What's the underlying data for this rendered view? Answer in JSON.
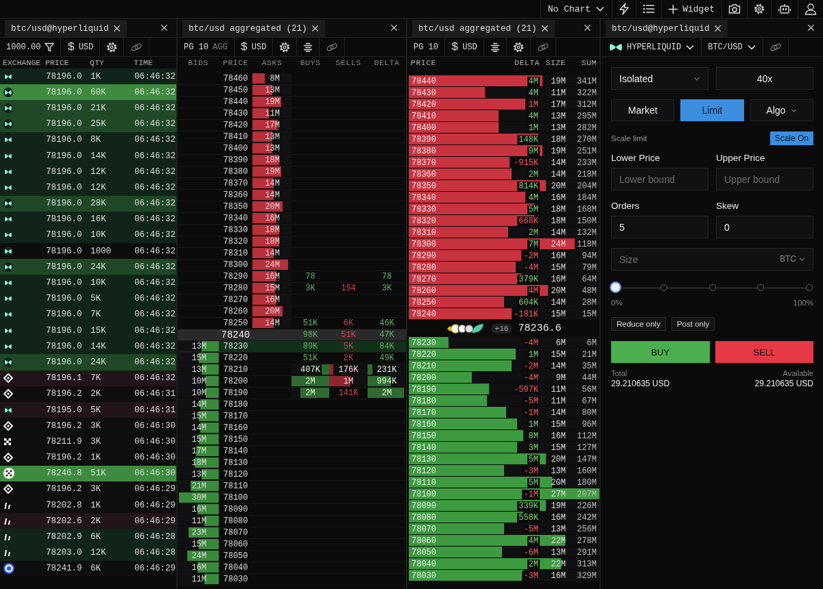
{
  "top_bar": {
    "chart_select": "No Chart",
    "widget_button": "Widget"
  },
  "trades_panel": {
    "tab": "btc/usd@hyperliquid",
    "filter_value": "1000.00",
    "currency_symbol": "$",
    "currency": "USD",
    "columns": [
      "EXCHANGE",
      "PRICE",
      "QTY",
      "TIME"
    ],
    "rows": [
      {
        "kind": "bowtie",
        "color": "#11241a",
        "price": "78196.0",
        "qty": "1K",
        "time": "06:46:32"
      },
      {
        "kind": "bowtie",
        "color": "#3e8b3f",
        "price": "78196.0",
        "qty": "60K",
        "time": "06:46:32"
      },
      {
        "kind": "bowtie",
        "color": "#1e4826",
        "price": "78196.0",
        "qty": "21K",
        "time": "06:46:32"
      },
      {
        "kind": "bowtie",
        "color": "#1e4826",
        "price": "78196.0",
        "qty": "25K",
        "time": "06:46:32"
      },
      {
        "kind": "bowtie",
        "color": "#11241a",
        "price": "78196.0",
        "qty": "8K",
        "time": "06:46:32"
      },
      {
        "kind": "bowtie",
        "color": "#11241a",
        "price": "78196.0",
        "qty": "14K",
        "time": "06:46:32"
      },
      {
        "kind": "bowtie",
        "color": "#11241a",
        "price": "78196.0",
        "qty": "12K",
        "time": "06:46:32"
      },
      {
        "kind": "bowtie",
        "color": "#11241a",
        "price": "78196.0",
        "qty": "12K",
        "time": "06:46:32"
      },
      {
        "kind": "bowtie",
        "color": "#1e4826",
        "price": "78196.0",
        "qty": "28K",
        "time": "06:46:32"
      },
      {
        "kind": "bowtie",
        "color": "#11241a",
        "price": "78196.0",
        "qty": "16K",
        "time": "06:46:32"
      },
      {
        "kind": "bowtie",
        "color": "#11241a",
        "price": "78196.0",
        "qty": "10K",
        "time": "06:46:32"
      },
      {
        "kind": "bowtie",
        "color": "#0d0d0e",
        "price": "78196.0",
        "qty": "1000",
        "time": "06:46:32"
      },
      {
        "kind": "bowtie",
        "color": "#1e4826",
        "price": "78196.0",
        "qty": "24K",
        "time": "06:46:32"
      },
      {
        "kind": "bowtie",
        "color": "#11241a",
        "price": "78196.0",
        "qty": "10K",
        "time": "06:46:32"
      },
      {
        "kind": "bowtie",
        "color": "#11241a",
        "price": "78196.0",
        "qty": "5K",
        "time": "06:46:32"
      },
      {
        "kind": "bowtie",
        "color": "#11241a",
        "price": "78196.0",
        "qty": "7K",
        "time": "06:46:32"
      },
      {
        "kind": "bowtie",
        "color": "#11241a",
        "price": "78196.0",
        "qty": "15K",
        "time": "06:46:32"
      },
      {
        "kind": "bowtie",
        "color": "#11241a",
        "price": "78196.0",
        "qty": "14K",
        "time": "06:46:32"
      },
      {
        "kind": "bowtie",
        "color": "#1e4826",
        "price": "78196.0",
        "qty": "24K",
        "time": "06:46:32"
      },
      {
        "kind": "diamond",
        "color": "#21141a",
        "price": "78196.1",
        "qty": "7K",
        "time": "06:46:32"
      },
      {
        "kind": "diamond",
        "color": "#0e0d0f",
        "price": "78196.2",
        "qty": "2K",
        "time": "06:46:31"
      },
      {
        "kind": "bowtie",
        "color": "#21141a",
        "price": "78195.0",
        "qty": "5K",
        "time": "06:46:31"
      },
      {
        "kind": "diamond",
        "color": "#0e0d0f",
        "price": "78196.2",
        "qty": "3K",
        "time": "06:46:30"
      },
      {
        "kind": "checker",
        "color": "#0e0d0f",
        "price": "78211.9",
        "qty": "3K",
        "time": "06:46:30"
      },
      {
        "kind": "diamond",
        "color": "#0e0d0f",
        "price": "78196.2",
        "qty": "1K",
        "time": "06:46:30"
      },
      {
        "kind": "dotted",
        "color": "#3e8b3f",
        "price": "78246.8",
        "qty": "51K",
        "time": "06:46:30"
      },
      {
        "kind": "diamond",
        "color": "#0e0d0f",
        "price": "78196.2",
        "qty": "3K",
        "time": "06:46:29"
      },
      {
        "kind": "slash",
        "color": "#0e0d0f",
        "price": "78202.8",
        "qty": "1K",
        "time": "06:46:29"
      },
      {
        "kind": "slash",
        "color": "#21141a",
        "price": "78202.6",
        "qty": "2K",
        "time": "06:46:29"
      },
      {
        "kind": "slash",
        "color": "#11241a",
        "price": "78202.9",
        "qty": "6K",
        "time": "06:46:28"
      },
      {
        "kind": "slash",
        "color": "#11241a",
        "price": "78203.0",
        "qty": "12K",
        "time": "06:46:28"
      },
      {
        "kind": "ring",
        "color": "#0e0d0f",
        "price": "78241.9",
        "qty": "6K",
        "time": "06:46:29"
      }
    ]
  },
  "ladder_panel": {
    "tab": "btc/usd aggregated (21)",
    "page": "PG 10",
    "agg": "AGG",
    "currency_symbol": "$",
    "currency": "USD",
    "columns": [
      "BIDS",
      "PRICE",
      "ASKS",
      "BUYS",
      "SELLS",
      "DELTA"
    ],
    "rows": [
      {
        "kind": "ask",
        "highlight": false,
        "price": "78460",
        "size": {
          "text": "8M",
          "level": 0.31
        }
      },
      {
        "kind": "ask",
        "highlight": false,
        "price": "78450",
        "size": {
          "text": "13M",
          "level": 0.5
        }
      },
      {
        "kind": "ask",
        "highlight": false,
        "price": "78440",
        "size": {
          "text": "19M",
          "level": 0.73
        }
      },
      {
        "kind": "ask",
        "highlight": false,
        "price": "78430",
        "size": {
          "text": "11M",
          "level": 0.42
        }
      },
      {
        "kind": "ask",
        "highlight": false,
        "price": "78420",
        "size": {
          "text": "17M",
          "level": 0.65
        }
      },
      {
        "kind": "ask",
        "highlight": false,
        "price": "78410",
        "size": {
          "text": "13M",
          "level": 0.5
        }
      },
      {
        "kind": "ask",
        "highlight": false,
        "price": "78400",
        "size": {
          "text": "13M",
          "level": 0.5
        }
      },
      {
        "kind": "ask",
        "highlight": false,
        "price": "78390",
        "size": {
          "text": "18M",
          "level": 0.69
        }
      },
      {
        "kind": "ask",
        "highlight": false,
        "price": "78380",
        "size": {
          "text": "19M",
          "level": 0.73
        }
      },
      {
        "kind": "ask",
        "highlight": false,
        "price": "78370",
        "size": {
          "text": "14M",
          "level": 0.54
        }
      },
      {
        "kind": "ask",
        "highlight": false,
        "price": "78360",
        "size": {
          "text": "14M",
          "level": 0.54
        }
      },
      {
        "kind": "ask",
        "highlight": false,
        "price": "78350",
        "size": {
          "text": "20M",
          "level": 0.77
        }
      },
      {
        "kind": "ask",
        "highlight": false,
        "price": "78340",
        "size": {
          "text": "16M",
          "level": 0.62
        }
      },
      {
        "kind": "ask",
        "highlight": false,
        "price": "78330",
        "size": {
          "text": "18M",
          "level": 0.69
        }
      },
      {
        "kind": "ask",
        "highlight": false,
        "price": "78320",
        "size": {
          "text": "18M",
          "level": 0.69
        }
      },
      {
        "kind": "ask",
        "highlight": false,
        "price": "78310",
        "size": {
          "text": "14M",
          "level": 0.54
        }
      },
      {
        "kind": "ask",
        "highlight": false,
        "price": "78300",
        "size": {
          "text": "24M",
          "level": 0.92
        }
      },
      {
        "kind": "ask",
        "highlight": false,
        "price": "78290",
        "size": {
          "text": "16M",
          "level": 0.62
        },
        "buys": {
          "text": "78"
        },
        "delta": {
          "text": "78"
        }
      },
      {
        "kind": "ask",
        "highlight": false,
        "price": "78280",
        "size": {
          "text": "15M",
          "level": 0.58
        },
        "buys": {
          "text": "3K"
        },
        "sells": {
          "text": "154"
        },
        "delta": {
          "text": "3K"
        }
      },
      {
        "kind": "ask",
        "highlight": false,
        "price": "78270",
        "size": {
          "text": "16M",
          "level": 0.62
        }
      },
      {
        "kind": "ask",
        "highlight": false,
        "price": "78260",
        "size": {
          "text": "20M",
          "level": 0.77
        }
      },
      {
        "kind": "ask",
        "highlight": false,
        "price": "78250",
        "size": {
          "text": "14M",
          "level": 0.54
        },
        "buys": {
          "text": "51K"
        },
        "sells": {
          "text": "6K"
        },
        "delta": {
          "text": "46K"
        }
      },
      {
        "kind": "mid",
        "highlight": false,
        "price": "78240",
        "buys": {
          "text": "98K"
        },
        "sells": {
          "text": "51K"
        },
        "delta": {
          "text": "47K"
        }
      },
      {
        "kind": "bid",
        "highlight": true,
        "price": "78230",
        "size": {
          "text": "13M",
          "level": 0.42
        },
        "buys": {
          "text": "89K"
        },
        "sells": {
          "text": "5K"
        },
        "delta": {
          "text": "84K"
        }
      },
      {
        "kind": "bid",
        "highlight": false,
        "price": "78220",
        "size": {
          "text": "15M",
          "level": 0.48
        },
        "buys": {
          "text": "51K"
        },
        "sells": {
          "text": "2K"
        },
        "delta": {
          "text": "49K"
        }
      },
      {
        "kind": "bid",
        "highlight": false,
        "price": "78210",
        "size": {
          "text": "13M",
          "level": 0.42
        },
        "buys": {
          "text": "407K",
          "level": 0.2
        },
        "sells": {
          "text": "176K",
          "level": 0.1
        },
        "delta": {
          "text": "231K",
          "level": 0.12
        }
      },
      {
        "kind": "bid",
        "highlight": false,
        "price": "78200",
        "size": {
          "text": "10M",
          "level": 0.32
        },
        "buys": {
          "text": "2M",
          "level": 1
        },
        "sells": {
          "text": "1M",
          "level": 0.55
        },
        "delta": {
          "text": "994K",
          "level": 0.6
        }
      },
      {
        "kind": "bid",
        "highlight": false,
        "price": "78190",
        "size": {
          "text": "10M",
          "level": 0.32
        },
        "buys": {
          "text": "2M",
          "level": 0.77
        },
        "sells": {
          "text": "141K"
        },
        "delta": {
          "text": "2M",
          "level": 0.95
        }
      },
      {
        "kind": "bid",
        "highlight": false,
        "price": "78180",
        "size": {
          "text": "14M",
          "level": 0.45
        }
      },
      {
        "kind": "bid",
        "highlight": false,
        "price": "78170",
        "size": {
          "text": "15M",
          "level": 0.48
        }
      },
      {
        "kind": "bid",
        "highlight": false,
        "price": "78160",
        "size": {
          "text": "14M",
          "level": 0.45
        }
      },
      {
        "kind": "bid",
        "highlight": false,
        "price": "78150",
        "size": {
          "text": "15M",
          "level": 0.48
        }
      },
      {
        "kind": "bid",
        "highlight": false,
        "price": "78140",
        "size": {
          "text": "17M",
          "level": 0.55
        }
      },
      {
        "kind": "bid",
        "highlight": false,
        "price": "78130",
        "size": {
          "text": "18M",
          "level": 0.58
        }
      },
      {
        "kind": "bid",
        "highlight": false,
        "price": "78120",
        "size": {
          "text": "13M",
          "level": 0.42
        }
      },
      {
        "kind": "bid",
        "highlight": false,
        "price": "78110",
        "size": {
          "text": "21M",
          "level": 0.68
        }
      },
      {
        "kind": "bid",
        "highlight": false,
        "price": "78100",
        "size": {
          "text": "30M",
          "level": 0.97
        }
      },
      {
        "kind": "bid",
        "highlight": false,
        "price": "78090",
        "size": {
          "text": "16M",
          "level": 0.52
        }
      },
      {
        "kind": "bid",
        "highlight": false,
        "price": "78080",
        "size": {
          "text": "11M",
          "level": 0.35
        }
      },
      {
        "kind": "bid",
        "highlight": false,
        "price": "78070",
        "size": {
          "text": "23M",
          "level": 0.74
        }
      },
      {
        "kind": "bid",
        "highlight": false,
        "price": "78060",
        "size": {
          "text": "15M",
          "level": 0.48
        }
      },
      {
        "kind": "bid",
        "highlight": false,
        "price": "78050",
        "size": {
          "text": "24M",
          "level": 0.77
        }
      },
      {
        "kind": "bid",
        "highlight": false,
        "price": "78040",
        "size": {
          "text": "16M",
          "level": 0.52
        }
      },
      {
        "kind": "bid",
        "highlight": false,
        "price": "78030",
        "size": {
          "text": "11M",
          "level": 0.35
        }
      }
    ]
  },
  "book_panel": {
    "tab": "btc/usd aggregated (21)",
    "page": "PG 10",
    "currency_symbol": "$",
    "currency": "USD",
    "columns": [
      "PRICE",
      "DELTA",
      "SIZE",
      "SUM"
    ],
    "asks": [
      {
        "price": "78440",
        "delta": "4M",
        "negative": false,
        "size": "19M",
        "sum": "341M",
        "level": 0.7
      },
      {
        "price": "78430",
        "delta": "4M",
        "negative": false,
        "size": "11M",
        "sum": "322M",
        "level": 0.4
      },
      {
        "price": "78420",
        "delta": "1M",
        "negative": true,
        "size": "17M",
        "sum": "312M",
        "level": 0.61
      },
      {
        "price": "78410",
        "delta": "4M",
        "negative": false,
        "size": "13M",
        "sum": "295M",
        "level": 0.47
      },
      {
        "price": "78400",
        "delta": "1M",
        "negative": false,
        "size": "13M",
        "sum": "282M",
        "level": 0.47
      },
      {
        "price": "78390",
        "delta": "148K",
        "negative": false,
        "size": "18M",
        "sum": "270M",
        "level": 0.68
      },
      {
        "price": "78380",
        "delta": "9M",
        "negative": false,
        "size": "19M",
        "sum": "251M",
        "level": 0.7
      },
      {
        "price": "78370",
        "delta": "-915K",
        "negative": true,
        "size": "14M",
        "sum": "233M",
        "level": 0.53
      },
      {
        "price": "78360",
        "delta": "2M",
        "negative": false,
        "size": "14M",
        "sum": "218M",
        "level": 0.54
      },
      {
        "price": "78350",
        "delta": "814K",
        "negative": false,
        "size": "20M",
        "sum": "204M",
        "level": 0.72
      },
      {
        "price": "78340",
        "delta": "4M",
        "negative": false,
        "size": "16M",
        "sum": "184M",
        "level": 0.61
      },
      {
        "price": "78330",
        "delta": "5M",
        "negative": false,
        "size": "18M",
        "sum": "168M",
        "level": 0.66
      },
      {
        "price": "78320",
        "delta": "668K",
        "negative": true,
        "size": "18M",
        "sum": "150M",
        "level": 0.66
      },
      {
        "price": "78310",
        "delta": "2M",
        "negative": false,
        "size": "14M",
        "sum": "132M",
        "level": 0.52
      },
      {
        "price": "78300",
        "delta": "7M",
        "negative": false,
        "size": "24M",
        "sum": "118M",
        "level": 0.87
      },
      {
        "price": "78290",
        "delta": "-2M",
        "negative": true,
        "size": "16M",
        "sum": "94M",
        "level": 0.59
      },
      {
        "price": "78280",
        "delta": "-4M",
        "negative": true,
        "size": "15M",
        "sum": "79M",
        "level": 0.56
      },
      {
        "price": "78270",
        "delta": "379K",
        "negative": false,
        "size": "16M",
        "sum": "64M",
        "level": 0.59
      },
      {
        "price": "78260",
        "delta": "4M",
        "negative": true,
        "size": "20M",
        "sum": "48M",
        "level": 0.73
      },
      {
        "price": "78250",
        "delta": "604K",
        "negative": false,
        "size": "14M",
        "sum": "28M",
        "level": 0.5
      },
      {
        "price": "78240",
        "delta": "-181K",
        "negative": true,
        "size": "15M",
        "sum": "15M",
        "level": 0.54
      }
    ],
    "mid": {
      "extra": "+16",
      "price": "78236.6"
    },
    "bids": [
      {
        "price": "78230",
        "delta": "-4M",
        "negative": true,
        "size": "6M",
        "sum": "6M",
        "level": 0.21
      },
      {
        "price": "78220",
        "delta": "1M",
        "negative": false,
        "size": "15M",
        "sum": "21M",
        "level": 0.56
      },
      {
        "price": "78210",
        "delta": "-2M",
        "negative": true,
        "size": "14M",
        "sum": "35M",
        "level": 0.54
      },
      {
        "price": "78200",
        "delta": "-4M",
        "negative": true,
        "size": "9M",
        "sum": "44M",
        "level": 0.33
      },
      {
        "price": "78190",
        "delta": "-597K",
        "negative": true,
        "size": "11M",
        "sum": "56M",
        "level": 0.42
      },
      {
        "price": "78180",
        "delta": "-5M",
        "negative": true,
        "size": "11M",
        "sum": "67M",
        "level": 0.41
      },
      {
        "price": "78170",
        "delta": "-1M",
        "negative": true,
        "size": "14M",
        "sum": "80M",
        "level": 0.51
      },
      {
        "price": "78160",
        "delta": "1M",
        "negative": false,
        "size": "15M",
        "sum": "96M",
        "level": 0.57
      },
      {
        "price": "78150",
        "delta": "8M",
        "negative": false,
        "size": "16M",
        "sum": "112M",
        "level": 0.6
      },
      {
        "price": "78140",
        "delta": "3M",
        "negative": false,
        "size": "15M",
        "sum": "127M",
        "level": 0.57
      },
      {
        "price": "78130",
        "delta": "5M",
        "negative": false,
        "size": "20M",
        "sum": "147M",
        "level": 0.72
      },
      {
        "price": "78120",
        "delta": "-3M",
        "negative": true,
        "size": "13M",
        "sum": "160M",
        "level": 0.5
      },
      {
        "price": "78110",
        "delta": "5M",
        "negative": false,
        "size": "20M",
        "sum": "180M",
        "level": 0.75
      },
      {
        "price": "78100",
        "delta": "-1M",
        "negative": true,
        "size": "27M",
        "sum": "207M",
        "level": 1
      },
      {
        "price": "78090",
        "delta": "339K",
        "negative": false,
        "size": "19M",
        "sum": "226M",
        "level": 0.72
      },
      {
        "price": "78080",
        "delta": "558K",
        "negative": false,
        "size": "16M",
        "sum": "242M",
        "level": 0.6
      },
      {
        "price": "78070",
        "delta": "-5M",
        "negative": true,
        "size": "13M",
        "sum": "256M",
        "level": 0.5
      },
      {
        "price": "78060",
        "delta": "4M",
        "negative": false,
        "size": "22M",
        "sum": "278M",
        "level": 0.82
      },
      {
        "price": "78050",
        "delta": "-6M",
        "negative": true,
        "size": "13M",
        "sum": "291M",
        "level": 0.49
      },
      {
        "price": "78040",
        "delta": "2M",
        "negative": false,
        "size": "22M",
        "sum": "313M",
        "level": 0.8
      },
      {
        "price": "78030",
        "delta": "-3M",
        "negative": true,
        "size": "16M",
        "sum": "329M",
        "level": 0.6
      }
    ]
  },
  "order_panel": {
    "tab": "btc/usd@hyperliquid",
    "exchange": "HYPERLIQUID",
    "pair": "BTC/USD",
    "margin_mode": "Isolated",
    "leverage": "40x",
    "order_types": [
      {
        "label": "Market",
        "selected": false,
        "dropdown": false
      },
      {
        "label": "Limit",
        "selected": true,
        "dropdown": false
      },
      {
        "label": "Algo",
        "selected": false,
        "dropdown": true
      }
    ],
    "scale_label": "Scale limit",
    "scale_button": {
      "label": "Scale On",
      "on": true
    },
    "price_fields": [
      {
        "label": "Lower Price",
        "placeholder": "Lower bound"
      },
      {
        "label": "Upper Price",
        "placeholder": "Upper bound"
      }
    ],
    "param_fields": [
      {
        "label": "Orders",
        "value": "5"
      },
      {
        "label": "Skew",
        "value": "0"
      }
    ],
    "size": {
      "placeholder": "Size",
      "unit": "BTC"
    },
    "slider": {
      "level": 0,
      "min_label": "0%",
      "max_label": "100%"
    },
    "options": [
      {
        "label": "Reduce only",
        "checked": false
      },
      {
        "label": "Post only",
        "checked": false
      }
    ],
    "buy": "BUY",
    "sell": "SELL",
    "total": {
      "label": "Total",
      "value": "29.210635 USD"
    },
    "available": {
      "label": "Available",
      "value": "29.210635 USD"
    }
  }
}
